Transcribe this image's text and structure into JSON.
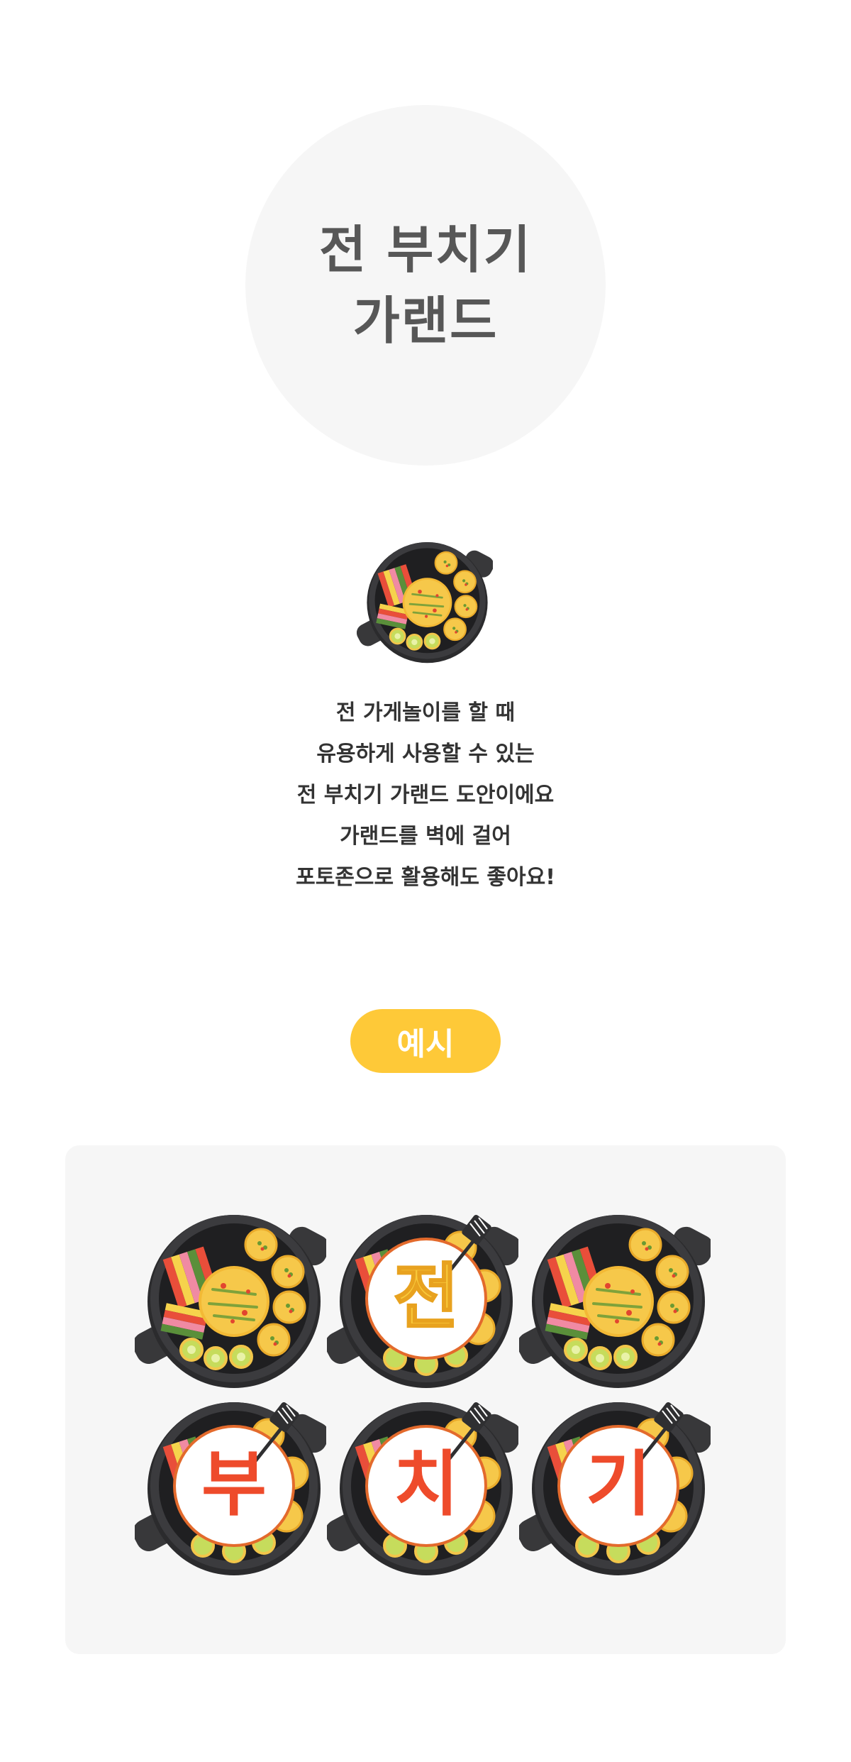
{
  "title": {
    "line1": "전 부치기",
    "line2": "가랜드"
  },
  "description": [
    "전 가게놀이를 할 때",
    "유용하게 사용할 수 있는",
    "전 부치기 가랜드 도안이에요",
    "가랜드를 벽에 걸어",
    "포토존으로 활용해도 좋아요!"
  ],
  "example": {
    "label": "예시"
  },
  "garland": {
    "letters": [
      "전",
      "부",
      "치",
      "기"
    ],
    "letter_colors": {
      "jeon": "#f8c93a",
      "others": "#ee4b2b"
    }
  },
  "colors": {
    "title_text": "#575757",
    "body_text": "#333333",
    "accent_yellow": "#fec938",
    "panel_bg": "#f6f6f6",
    "pan_dark": "#2f2f31"
  },
  "icons": {
    "hero": "jeon-pan-icon",
    "spatula": "spatula-icon"
  }
}
